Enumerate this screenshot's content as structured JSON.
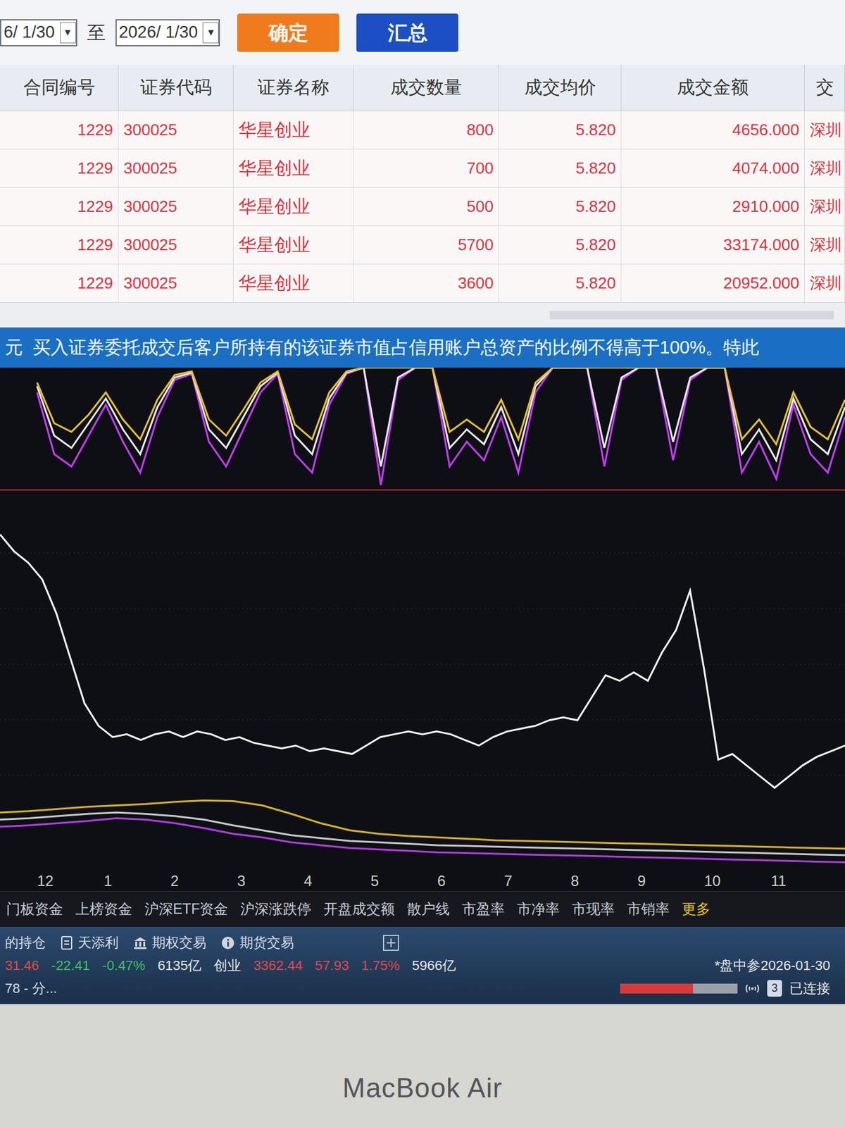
{
  "toolbar": {
    "date_from": "6/ 1/30",
    "separator": "至",
    "date_to": "2026/ 1/30",
    "dropdown_glyph": "▾",
    "buttons": [
      {
        "label": "确定",
        "color": "#f07b1d"
      },
      {
        "label": "汇总",
        "color": "#1d4fc4"
      }
    ]
  },
  "table": {
    "columns": [
      "合同编号",
      "证券代码",
      "证券名称",
      "成交数量",
      "成交均价",
      "成交金额",
      "交"
    ],
    "rows": [
      [
        "1229",
        "300025",
        "华星创业",
        "800",
        "5.820",
        "4656.000",
        "深圳"
      ],
      [
        "1229",
        "300025",
        "华星创业",
        "700",
        "5.820",
        "4074.000",
        "深圳"
      ],
      [
        "1229",
        "300025",
        "华星创业",
        "500",
        "5.820",
        "2910.000",
        "深圳"
      ],
      [
        "1229",
        "300025",
        "华星创业",
        "5700",
        "5.820",
        "33174.000",
        "深圳"
      ],
      [
        "1229",
        "300025",
        "华星创业",
        "3600",
        "5.820",
        "20952.000",
        "深圳"
      ]
    ]
  },
  "banner": {
    "text": "元  买入证券委托成交后客户所持有的该证券市值占信用账户总资产的比例不得高于100%。特此"
  },
  "chart": {
    "indicator_series": [
      {
        "name": "purple",
        "color": "#c23cf0",
        "values": [
          20,
          70,
          80,
          55,
          30,
          60,
          85,
          40,
          10,
          5,
          60,
          80,
          50,
          20,
          5,
          70,
          85,
          30,
          5,
          0,
          95,
          10,
          0,
          0,
          80,
          60,
          75,
          40,
          85,
          20,
          0,
          0,
          0,
          80,
          10,
          0,
          0,
          75,
          10,
          0,
          0,
          85,
          60,
          90,
          30,
          70,
          85,
          40
        ]
      },
      {
        "name": "white",
        "color": "#e8e8e8",
        "values": [
          15,
          55,
          65,
          45,
          25,
          50,
          70,
          32,
          8,
          4,
          50,
          65,
          40,
          15,
          4,
          55,
          70,
          25,
          4,
          0,
          80,
          8,
          0,
          0,
          65,
          50,
          62,
          32,
          70,
          15,
          0,
          0,
          0,
          65,
          8,
          0,
          0,
          60,
          8,
          0,
          0,
          70,
          50,
          75,
          25,
          58,
          70,
          32
        ]
      },
      {
        "name": "yellow",
        "color": "#e6c229",
        "values": [
          12,
          45,
          52,
          38,
          20,
          42,
          58,
          26,
          6,
          3,
          42,
          55,
          34,
          12,
          3,
          46,
          58,
          20,
          3,
          0,
          0,
          0,
          0,
          0,
          52,
          42,
          52,
          26,
          58,
          12,
          0,
          0,
          0,
          0,
          0,
          0,
          0,
          0,
          0,
          0,
          0,
          58,
          42,
          62,
          20,
          48,
          58,
          26
        ]
      }
    ],
    "main_series": {
      "color": "#f2f2f2",
      "values": [
        9.6,
        9.3,
        9.1,
        8.8,
        8.2,
        7.4,
        6.6,
        6.2,
        6.0,
        6.05,
        5.95,
        6.05,
        6.1,
        6.0,
        6.1,
        6.05,
        5.95,
        6.0,
        5.9,
        5.85,
        5.8,
        5.85,
        5.75,
        5.8,
        5.75,
        5.7,
        5.85,
        6.0,
        6.05,
        6.1,
        6.05,
        6.1,
        6.05,
        5.95,
        5.85,
        6.0,
        6.1,
        6.15,
        6.2,
        6.3,
        6.35,
        6.3,
        6.7,
        7.1,
        7.0,
        7.15,
        7.0,
        7.5,
        7.9,
        8.6,
        7.2,
        5.6,
        5.7,
        5.5,
        5.3,
        5.1,
        5.3,
        5.5,
        5.65,
        5.75,
        5.85
      ]
    },
    "bottom_series": [
      {
        "name": "yellow",
        "color": "#d6b21e",
        "values": [
          80,
          82,
          85,
          88,
          90,
          92,
          95,
          97,
          96,
          90,
          78,
          65,
          55,
          50,
          47,
          45,
          43,
          41,
          40,
          39,
          38,
          37,
          36,
          35,
          34,
          33,
          32,
          31,
          30,
          29
        ]
      },
      {
        "name": "white",
        "color": "#c8c8c8",
        "values": [
          70,
          72,
          75,
          78,
          80,
          78,
          75,
          70,
          62,
          55,
          48,
          44,
          40,
          38,
          36,
          34,
          33,
          32,
          31,
          30,
          29,
          28,
          27,
          26,
          25,
          24,
          23,
          22,
          21,
          20
        ]
      },
      {
        "name": "purple",
        "color": "#b23ce0",
        "values": [
          60,
          62,
          65,
          68,
          72,
          70,
          65,
          58,
          50,
          45,
          38,
          34,
          30,
          28,
          26,
          24,
          23,
          22,
          21,
          20,
          19,
          18,
          17,
          16,
          15,
          14,
          13,
          12,
          11,
          10
        ]
      }
    ],
    "x_labels": [
      "12",
      "1",
      "2",
      "3",
      "4",
      "5",
      "6",
      "7",
      "8",
      "9",
      "10",
      "11"
    ]
  },
  "tabs": [
    {
      "label": "门板资金",
      "highlight": false
    },
    {
      "label": "上榜资金",
      "highlight": false
    },
    {
      "label": "沪深ETF资金",
      "highlight": false
    },
    {
      "label": "沪深涨跌停",
      "highlight": false
    },
    {
      "label": "开盘成交额",
      "highlight": false
    },
    {
      "label": "散户线",
      "highlight": false
    },
    {
      "label": "市盈率",
      "highlight": false
    },
    {
      "label": "市净率",
      "highlight": false
    },
    {
      "label": "市现率",
      "highlight": false
    },
    {
      "label": "市销率",
      "highlight": false
    },
    {
      "label": "更多",
      "highlight": true
    }
  ],
  "status_bar": {
    "links": [
      {
        "label": "的持仓",
        "kind": "plain"
      },
      {
        "label": "天添利",
        "kind": "doc"
      },
      {
        "label": "期权交易",
        "kind": "bank"
      },
      {
        "label": "期货交易",
        "kind": "info"
      }
    ],
    "quotes": [
      {
        "text": "31.46",
        "color": "#e04848"
      },
      {
        "text": "-22.41",
        "color": "#3cc060"
      },
      {
        "text": "-0.47%",
        "color": "#3cc060"
      },
      {
        "text": "6135亿",
        "color": "#e6e6e6"
      },
      {
        "text": "创业",
        "color": "#e6e6e6"
      },
      {
        "text": "3362.44",
        "color": "#e04848"
      },
      {
        "text": "57.93",
        "color": "#e04848"
      },
      {
        "text": "1.75%",
        "color": "#e04848"
      },
      {
        "text": "5966亿",
        "color": "#e6e6e6"
      }
    ],
    "footer_left": "78 - 分...",
    "session": "*盘中参2026-01-30",
    "market_level": 0.62,
    "connections": "3",
    "connection_status": "已连接"
  },
  "device": {
    "label": "MacBook Air"
  }
}
